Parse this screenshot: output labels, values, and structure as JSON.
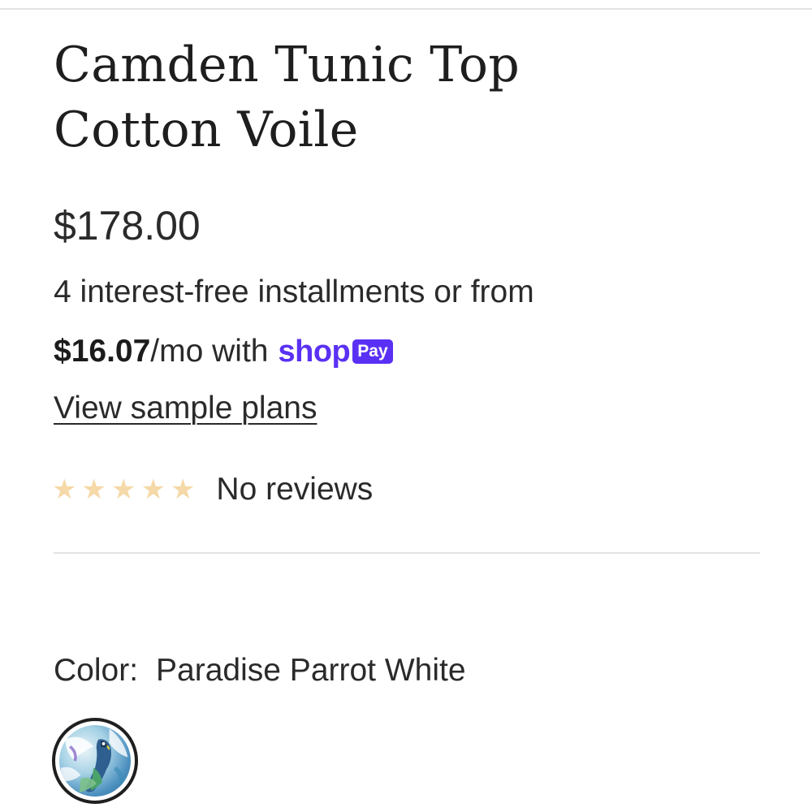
{
  "product": {
    "title_line1": "Camden Tunic Top",
    "title_line2": "Cotton Voile",
    "price": "$178.00"
  },
  "installments": {
    "line1": "4 interest-free installments or from",
    "monthly_amount": "$16.07",
    "monthly_suffix": "/mo with",
    "shop_wordmark": "shop",
    "pay_badge": "Pay",
    "view_plans_link": "View sample plans"
  },
  "reviews": {
    "stars": [
      "★",
      "★",
      "★",
      "★",
      "★"
    ],
    "rating_filled": 0,
    "text": "No reviews"
  },
  "variant": {
    "color_label": "Color:",
    "color_value": "Paradise Parrot White",
    "swatch_name": "parrot-print-swatch"
  },
  "colors": {
    "shop_pay_purple": "#5a31f4",
    "star_empty": "#f5d9a8",
    "text": "#2a2a2a",
    "divider": "#e3e3e3"
  }
}
